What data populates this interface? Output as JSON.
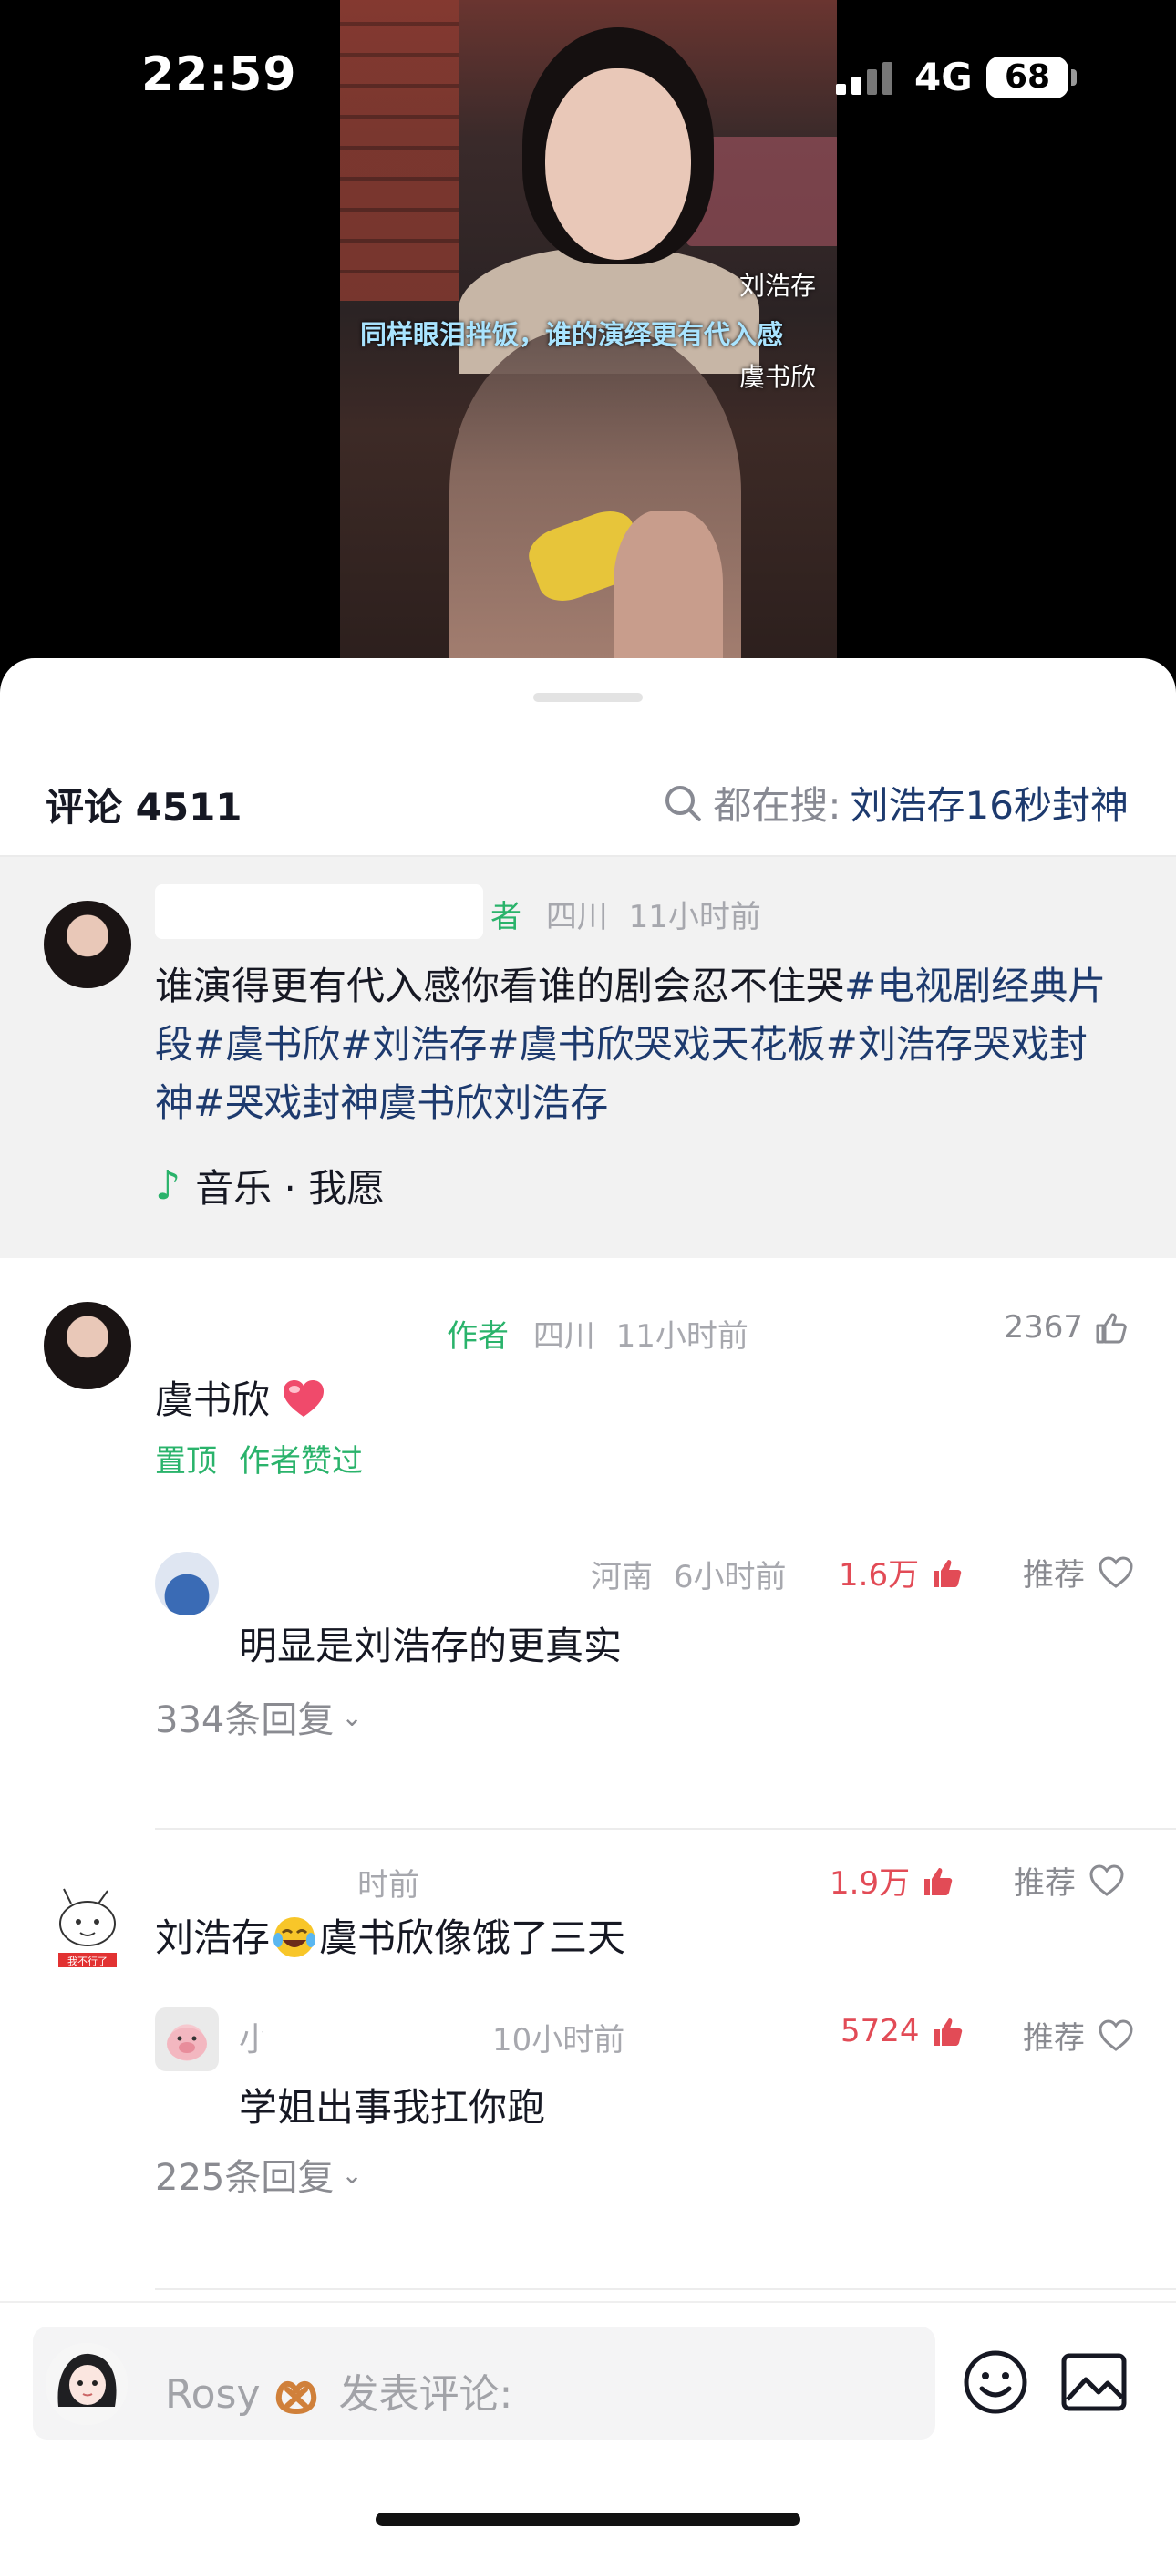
{
  "status_bar": {
    "time": "22:59",
    "network": "4G",
    "battery": "68"
  },
  "video": {
    "name_top": "刘浩存",
    "caption": "同样眼泪拌饭，谁的演绎更有代入感",
    "name_bottom": "虞书欣"
  },
  "header": {
    "comment_label": "评论 4511",
    "search_prefix": "都在搜:",
    "search_keyword": "刘浩存16秒封神"
  },
  "post": {
    "author_suffix": "者",
    "location": "四川",
    "time": "11小时前",
    "text_plain": "谁演得更有代入感你看谁的剧会忍不住哭",
    "tags": [
      "#电视剧经典片段",
      "#虞书欣",
      "#刘浩存",
      "#虞书欣哭戏天花板",
      "#刘浩存哭戏封神",
      "#哭戏封神虞书欣刘浩存"
    ],
    "music": "音乐 · 我愿"
  },
  "comments": [
    {
      "author_tag": "作者",
      "location": "四川",
      "time": "11小时前",
      "likes": "2367",
      "text": "虞书欣",
      "badges": [
        "置顶",
        "作者赞过"
      ],
      "reply": {
        "location": "河南",
        "time": "6小时前",
        "likes": "1.6万",
        "recommend": "推荐",
        "text": "明显是刘浩存的更真实"
      },
      "reply_count": "334条回复"
    },
    {
      "time": "时前",
      "likes": "1.9万",
      "recommend": "推荐",
      "text_before": "刘浩存",
      "text_after": "虞书欣像饿了三天",
      "avatar_caption": "我不行了",
      "reply": {
        "name": "小",
        "time": "10小时前",
        "likes": "5724",
        "recommend": "推荐",
        "text": "学姐出事我扛你跑"
      },
      "reply_count": "225条回复"
    }
  ],
  "input": {
    "user": "Rosy",
    "placeholder": "发表评论:"
  },
  "colors": {
    "accent_green": "#2ab36b",
    "like_red": "#e24b56",
    "tag_blue": "#1d3a6e"
  }
}
